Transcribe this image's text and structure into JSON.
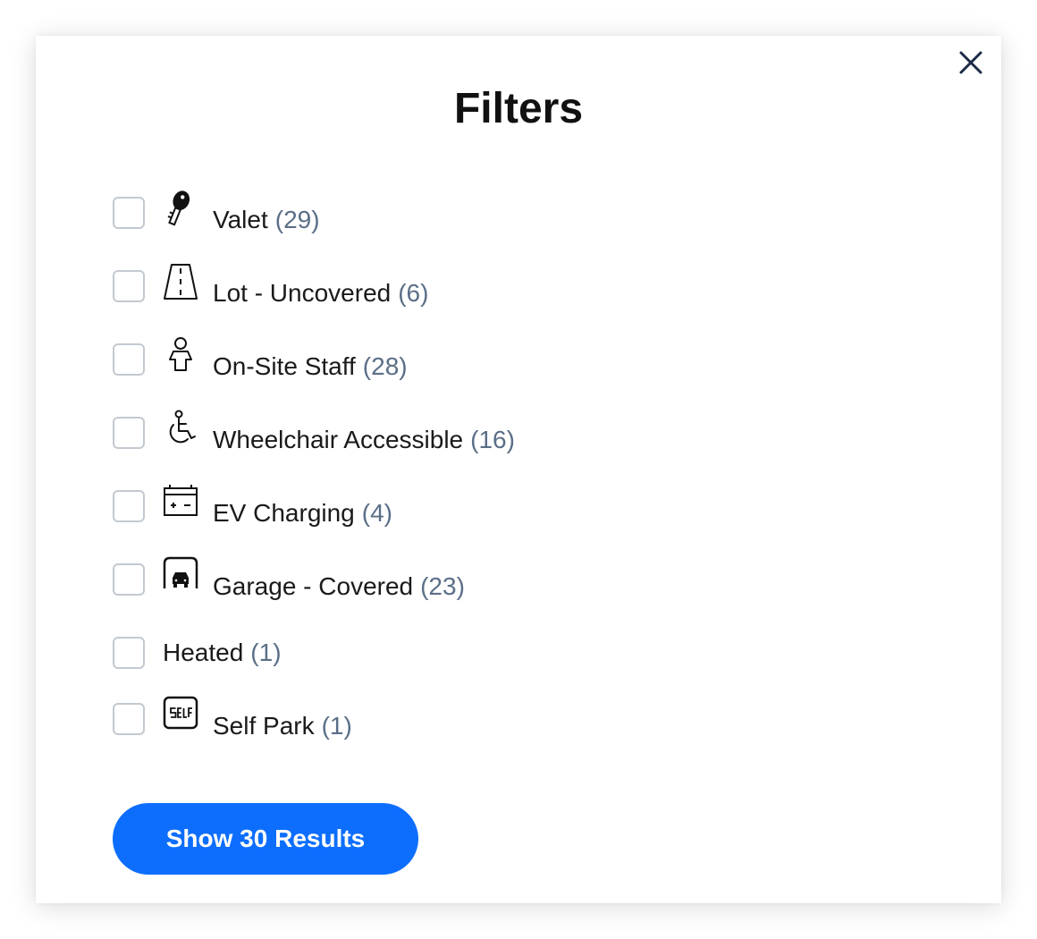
{
  "modal": {
    "title": "Filters",
    "close_icon": "close-icon"
  },
  "filters": [
    {
      "label": "Valet",
      "count": "(29)",
      "icon": "key-icon"
    },
    {
      "label": "Lot - Uncovered",
      "count": "(6)",
      "icon": "road-icon"
    },
    {
      "label": "On-Site Staff",
      "count": "(28)",
      "icon": "person-icon"
    },
    {
      "label": "Wheelchair Accessible",
      "count": "(16)",
      "icon": "wheelchair-icon"
    },
    {
      "label": "EV Charging",
      "count": "(4)",
      "icon": "battery-icon"
    },
    {
      "label": "Garage - Covered",
      "count": "(23)",
      "icon": "garage-icon"
    },
    {
      "label": "Heated",
      "count": "(1)",
      "icon": null
    },
    {
      "label": "Self Park",
      "count": "(1)",
      "icon": "self-park-icon"
    }
  ],
  "footer": {
    "show_results_label": "Show 30 Results"
  },
  "colors": {
    "accent": "#0d6efd",
    "count_text": "#5a6e87",
    "checkbox_border": "#c3c9d0",
    "close_icon": "#1b2a47"
  }
}
